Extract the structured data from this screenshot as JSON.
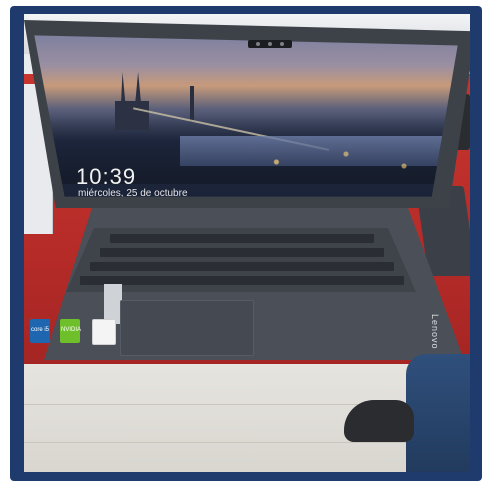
{
  "scene": {
    "subject": "laptop-photo",
    "colors": {
      "border": "#1f3b6e",
      "desk": "#c8352f",
      "laptop": "#4b5058",
      "screen_sky": "#9b8fa2",
      "clock_text": "#f2f2f2"
    }
  },
  "lockscreen": {
    "time": "10:39",
    "date": "miércoles, 25 de octubre"
  },
  "stickers": {
    "intel": "core i5",
    "nvidia": "NVIDIA"
  },
  "branding": {
    "logo": "Lenovo"
  }
}
